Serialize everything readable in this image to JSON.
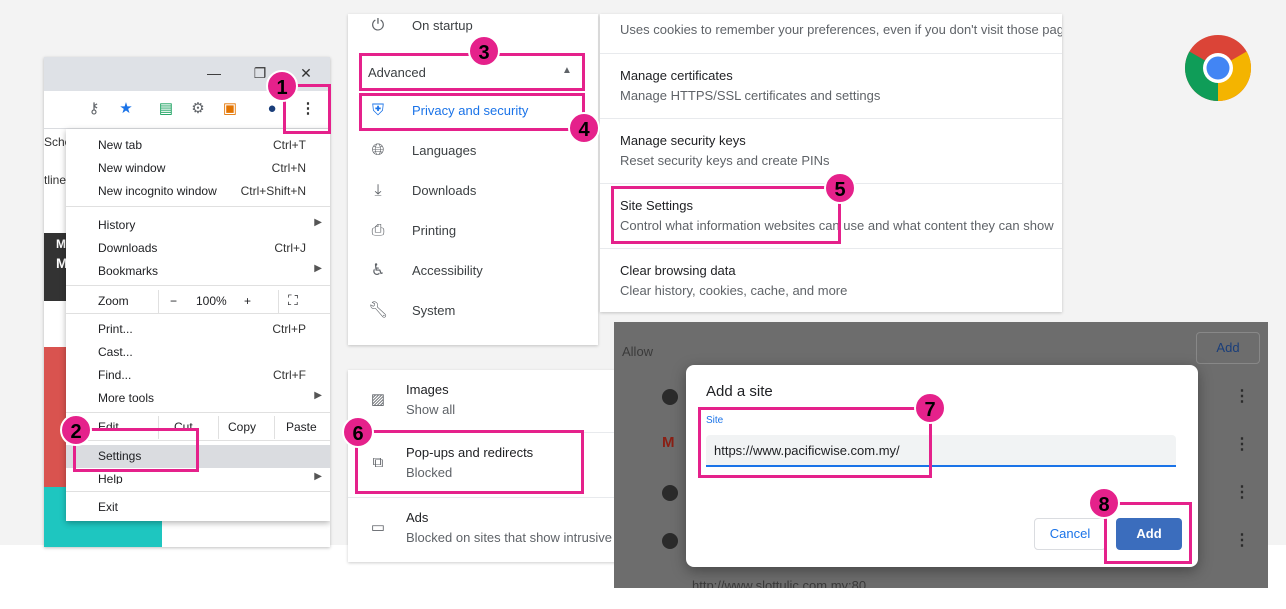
{
  "menu": {
    "items": {
      "new_tab": {
        "label": "New tab",
        "shortcut": "Ctrl+T"
      },
      "new_window": {
        "label": "New window",
        "shortcut": "Ctrl+N"
      },
      "new_incognito": {
        "label": "New incognito window",
        "shortcut": "Ctrl+Shift+N"
      },
      "history": {
        "label": "History"
      },
      "downloads": {
        "label": "Downloads",
        "shortcut": "Ctrl+J"
      },
      "bookmarks": {
        "label": "Bookmarks"
      },
      "zoom": {
        "label": "Zoom",
        "minus": "−",
        "value": "100%",
        "plus": "+"
      },
      "print": {
        "label": "Print...",
        "shortcut": "Ctrl+P"
      },
      "cast": {
        "label": "Cast..."
      },
      "find": {
        "label": "Find...",
        "shortcut": "Ctrl+F"
      },
      "more_tools": {
        "label": "More tools"
      },
      "edit": {
        "label": "Edit",
        "cut": "Cut",
        "copy": "Copy",
        "paste": "Paste"
      },
      "settings": {
        "label": "Settings"
      },
      "help": {
        "label": "Help"
      },
      "exit": {
        "label": "Exit"
      }
    },
    "page_fragments": [
      "Sche",
      "tline",
      "M",
      "M"
    ]
  },
  "settings_nav": {
    "on_startup": "On startup",
    "advanced": "Advanced",
    "privacy": "Privacy and security",
    "languages": "Languages",
    "downloads": "Downloads",
    "printing": "Printing",
    "accessibility": "Accessibility",
    "system": "System"
  },
  "privacy_rows": [
    {
      "title": "",
      "subtitle": "Uses cookies to remember your preferences, even if you don't visit those pag"
    },
    {
      "title": "Manage certificates",
      "subtitle": "Manage HTTPS/SSL certificates and settings"
    },
    {
      "title": "Manage security keys",
      "subtitle": "Reset security keys and create PINs"
    },
    {
      "title": "Site Settings",
      "subtitle": "Control what information websites can use and what content they can show"
    },
    {
      "title": "Clear browsing data",
      "subtitle": "Clear history, cookies, cache, and more"
    }
  ],
  "permissions": [
    {
      "title": "Images",
      "subtitle": "Show all",
      "icon": "image-icon"
    },
    {
      "title": "Pop-ups and redirects",
      "subtitle": "Blocked",
      "icon": "open-in-new-icon"
    },
    {
      "title": "Ads",
      "subtitle": "Blocked on sites that show intrusive",
      "icon": "window-icon"
    }
  ],
  "allow_section": {
    "label": "Allow",
    "add": "Add",
    "partial_url": "http://www.slottulic.com.my:80"
  },
  "dialog": {
    "title": "Add a site",
    "field_label": "Site",
    "field_value": "https://www.pacificwise.com.my/",
    "cancel": "Cancel",
    "add": "Add"
  },
  "steps": [
    "1",
    "2",
    "3",
    "4",
    "5",
    "6",
    "7",
    "8"
  ],
  "colors": {
    "annotation": "#e5218b",
    "accent": "#1a73e8",
    "add_button": "#3b6dbd"
  }
}
